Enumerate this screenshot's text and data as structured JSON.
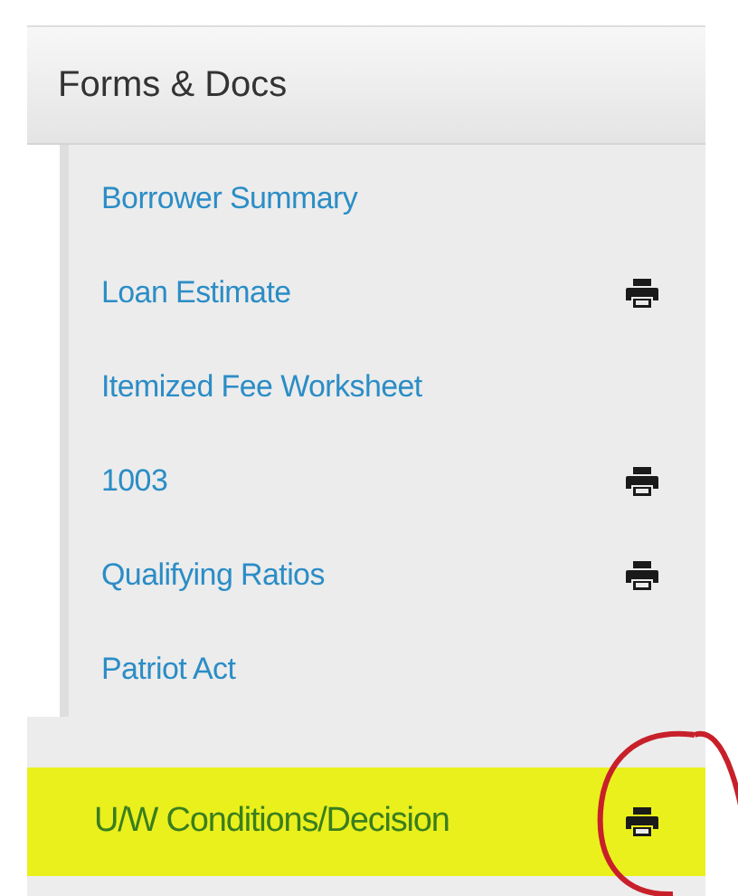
{
  "panel": {
    "title": "Forms & Docs"
  },
  "items": [
    {
      "label": "Borrower Summary",
      "printable": false,
      "highlighted": false,
      "annotated": false
    },
    {
      "label": "Loan Estimate",
      "printable": true,
      "highlighted": false,
      "annotated": false
    },
    {
      "label": "Itemized Fee Worksheet",
      "printable": false,
      "highlighted": false,
      "annotated": false
    },
    {
      "label": "1003",
      "printable": true,
      "highlighted": false,
      "annotated": false
    },
    {
      "label": "Qualifying Ratios",
      "printable": true,
      "highlighted": false,
      "annotated": false
    },
    {
      "label": "Patriot Act",
      "printable": false,
      "highlighted": false,
      "annotated": false
    },
    {
      "label": "U/W Conditions/Decision",
      "printable": true,
      "highlighted": true,
      "annotated": true
    }
  ]
}
